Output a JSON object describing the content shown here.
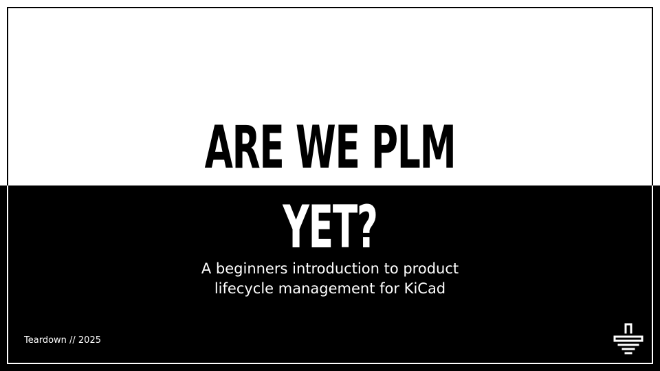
{
  "slide": {
    "title_line_1": "ARE WE PLM",
    "title_line_2": "YET?",
    "subtitle_line_1": "A beginners introduction to product",
    "subtitle_line_2": "lifecycle management for KiCad",
    "footer": "Teardown // 2025",
    "logo_icon": "kicad-logo-icon"
  },
  "colors": {
    "top_background": "#ffffff",
    "bottom_background": "#000000",
    "title_top": "#000000",
    "title_bottom": "#ffffff",
    "text": "#ffffff"
  }
}
